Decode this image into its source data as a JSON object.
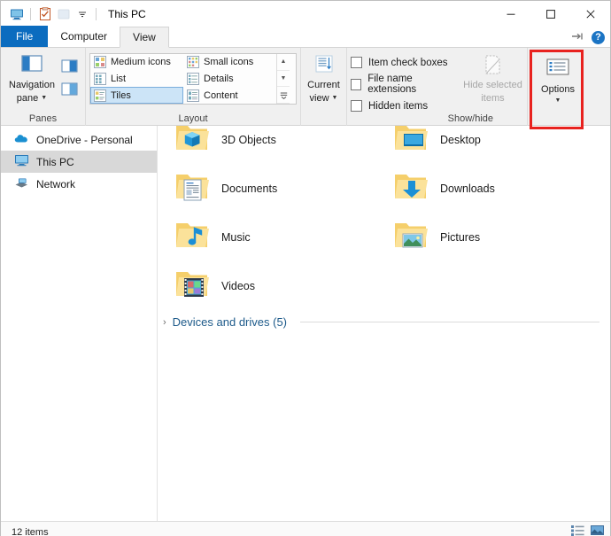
{
  "window": {
    "title": "This PC",
    "quick_access": [
      {
        "name": "this-pc-icon",
        "tooltip": "This PC"
      },
      {
        "name": "properties-icon",
        "tooltip": "Properties"
      },
      {
        "name": "new-folder-icon",
        "tooltip": "New folder"
      },
      {
        "name": "customize-quick-access-icon",
        "tooltip": "Customize Quick Access Toolbar"
      }
    ],
    "controls": {
      "minimize": "─",
      "maximize": "□",
      "close": "✕"
    }
  },
  "tabs": [
    {
      "label": "File",
      "state": "file"
    },
    {
      "label": "Computer",
      "state": "normal"
    },
    {
      "label": "View",
      "state": "active"
    }
  ],
  "ribbon_right": {
    "collapse_label": "→|",
    "help_label": "?"
  },
  "ribbon": {
    "groups": [
      {
        "label": "Panes",
        "big_button": {
          "label_line1": "Navigation",
          "label_line2": "pane",
          "has_caret": true,
          "disabled": false
        },
        "small_buttons": [
          {
            "name": "preview-pane-button"
          },
          {
            "name": "details-pane-button"
          }
        ]
      },
      {
        "label": "Layout",
        "items_left": [
          {
            "label": "Medium icons",
            "selected": false
          },
          {
            "label": "List",
            "selected": false
          },
          {
            "label": "Tiles",
            "selected": true
          }
        ],
        "items_right": [
          {
            "label": "Small icons",
            "selected": false
          },
          {
            "label": "Details",
            "selected": false
          },
          {
            "label": "Content",
            "selected": false
          }
        ],
        "scroll": [
          {
            "glyph": "▲",
            "name": "gallery-scroll-up-button"
          },
          {
            "glyph": "▼",
            "name": "gallery-scroll-down-button"
          },
          {
            "glyph": "☰",
            "name": "gallery-expand-button"
          }
        ]
      },
      {
        "label": "",
        "big_button": {
          "label_line1": "Current",
          "label_line2": "view",
          "has_caret": true,
          "disabled": false
        }
      },
      {
        "label": "Show/hide",
        "checkboxes": [
          {
            "label": "Item check boxes",
            "checked": false
          },
          {
            "label": "File name extensions",
            "checked": false
          },
          {
            "label": "Hidden items",
            "checked": false
          }
        ],
        "big_button": {
          "label_line1": "Hide selected",
          "label_line2": "items",
          "has_caret": false,
          "disabled": true
        }
      },
      {
        "label": "",
        "big_button": {
          "label_line1": "Options",
          "label_line2": "",
          "has_caret": true,
          "disabled": false
        }
      }
    ]
  },
  "annotation": {
    "color": "#e8221f",
    "target": "options-button"
  },
  "sidebar": {
    "items": [
      {
        "label": "OneDrive - Personal",
        "icon": "onedrive-cloud-icon",
        "selected": false
      },
      {
        "label": "This PC",
        "icon": "this-pc-monitor-icon",
        "selected": true
      },
      {
        "label": "Network",
        "icon": "network-icon",
        "selected": false
      }
    ]
  },
  "content": {
    "folders": [
      {
        "label": "3D Objects",
        "icon": "3d-objects-folder-icon"
      },
      {
        "label": "Desktop",
        "icon": "desktop-folder-icon"
      },
      {
        "label": "Documents",
        "icon": "documents-folder-icon"
      },
      {
        "label": "Downloads",
        "icon": "downloads-folder-icon"
      },
      {
        "label": "Music",
        "icon": "music-folder-icon"
      },
      {
        "label": "Pictures",
        "icon": "pictures-folder-icon"
      },
      {
        "label": "Videos",
        "icon": "videos-folder-icon"
      }
    ],
    "section": {
      "title": "Devices and drives (5)",
      "chevron": "›",
      "expanded": false
    }
  },
  "statusbar": {
    "item_count": "12 items",
    "views": [
      {
        "name": "details-view-button",
        "active": false
      },
      {
        "name": "large-icons-view-button",
        "active": true
      }
    ]
  }
}
